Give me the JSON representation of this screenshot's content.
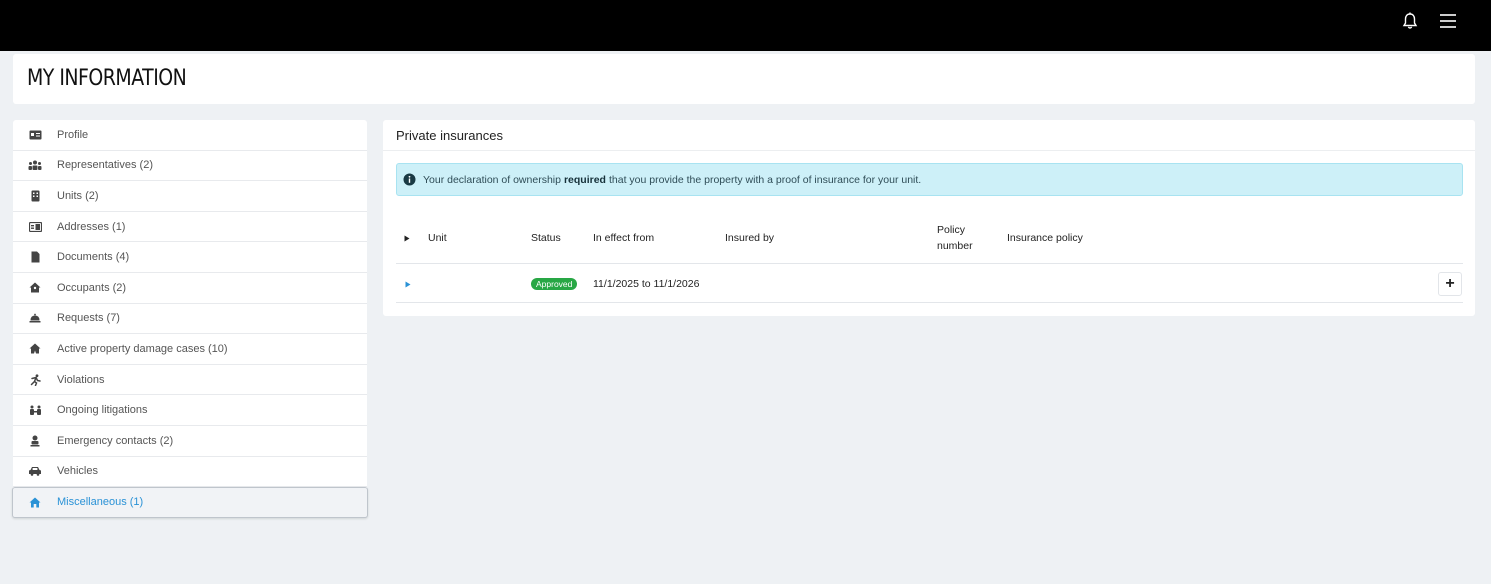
{
  "topbar": {
    "icons": [
      "bell-icon",
      "hamburger-menu-icon"
    ]
  },
  "header": {
    "title": "MY INFORMATION"
  },
  "sidebar": {
    "items": [
      {
        "label": "Profile",
        "icon": "id-card-icon"
      },
      {
        "label": "Representatives (2)",
        "icon": "people-group-icon"
      },
      {
        "label": "Units (2)",
        "icon": "building-icon"
      },
      {
        "label": "Addresses (1)",
        "icon": "address-card-icon"
      },
      {
        "label": "Documents (4)",
        "icon": "document-icon"
      },
      {
        "label": "Occupants (2)",
        "icon": "house-user-icon"
      },
      {
        "label": "Requests (7)",
        "icon": "bell-concierge-icon"
      },
      {
        "label": "Active property damage cases (10)",
        "icon": "house-damage-icon"
      },
      {
        "label": "Violations",
        "icon": "person-running-icon"
      },
      {
        "label": "Ongoing litigations",
        "icon": "people-arrows-icon"
      },
      {
        "label": "Emergency contacts (2)",
        "icon": "user-contact-icon"
      },
      {
        "label": "Vehicles",
        "icon": "car-icon"
      },
      {
        "label": "Miscellaneous (1)",
        "icon": "home-icon",
        "active": true
      }
    ],
    "active_color": "#2a92d6"
  },
  "main": {
    "title": "Private insurances",
    "alert": {
      "text_before": "Your declaration of ownership",
      "text_bold": "required",
      "text_after": "that you provide the property with a proof of insurance for your unit.",
      "icon": "info-circle-icon"
    },
    "table": {
      "headers": {
        "unit": "Unit",
        "status": "Status",
        "in_effect_from": "In effect from",
        "insured_by": "Insured by",
        "policy_number_line1": "Policy",
        "policy_number_line2": "number",
        "insurance_policy": "Insurance policy"
      },
      "rows": [
        {
          "unit": "",
          "status": "Approved",
          "in_effect_from": "11/1/2025 to 11/1/2026",
          "insured_by": "",
          "policy_number": "",
          "insurance_policy": ""
        }
      ],
      "add_button_label": "+"
    },
    "status_color": "#28a745"
  }
}
